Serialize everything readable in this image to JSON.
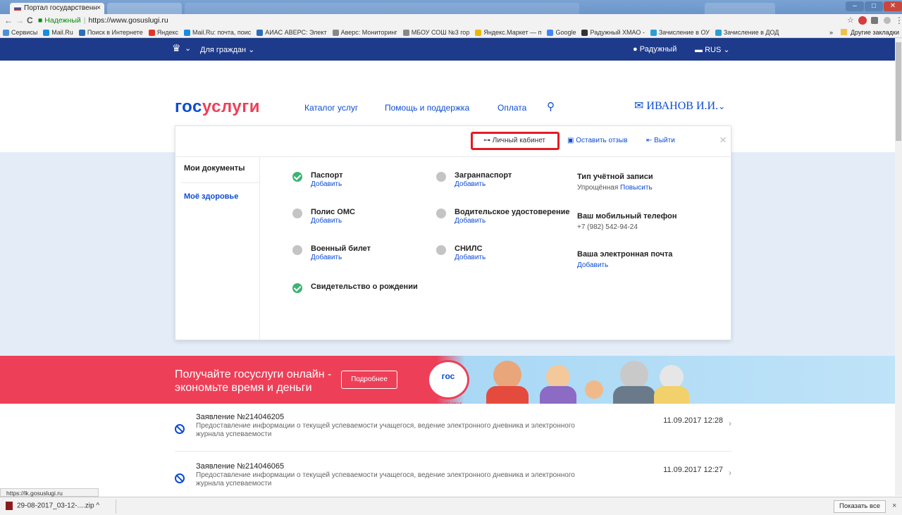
{
  "browser": {
    "tab_title": "Портал государственн",
    "tab_close": "×",
    "back": "←",
    "forward": "→",
    "reload": "C",
    "secure_label": "Надежный",
    "url": "https://www.gosuslugi.ru",
    "bookmarks": [
      {
        "label": "Сервисы",
        "color": "#4a90d9"
      },
      {
        "label": "Mail.Ru",
        "color": "#168de2"
      },
      {
        "label": "Поиск в Интернете",
        "color": "#2a6ebb"
      },
      {
        "label": "Яндекс",
        "color": "#e6332a"
      },
      {
        "label": "Mail.Ru: почта, поис",
        "color": "#168de2"
      },
      {
        "label": "АИАС АВЕРС: Элект",
        "color": "#2a6ebb"
      },
      {
        "label": "Аверс: Мониторинг",
        "color": "#888888"
      },
      {
        "label": "МБОУ СОШ №3 гор",
        "color": "#888888"
      },
      {
        "label": "Яндекс.Маркет — п",
        "color": "#f0b400"
      },
      {
        "label": "Google",
        "color": "#4285f4"
      },
      {
        "label": "Радужный ХМАО -",
        "color": "#333333"
      },
      {
        "label": "Зачисление в ОУ",
        "color": "#2a9fd6"
      },
      {
        "label": "Зачисление в ДОД",
        "color": "#2a9fd6"
      }
    ],
    "bookmarks_more": "»",
    "other_bookmarks": "Другие закладки",
    "status_url": "https://lk.gosuslugi.ru"
  },
  "site_nav": {
    "emblem_label": "⌄",
    "for_citizens": "Для граждан",
    "location": "Радужный",
    "language": "RUS"
  },
  "header": {
    "logo_part1": "гос",
    "logo_part2": "услуги",
    "nav": [
      "Каталог услуг",
      "Помощь и поддержка",
      "Оплата"
    ],
    "user_name": "ИВАНОВ И.И."
  },
  "panel": {
    "personal_cabinet": "Личный кабинет",
    "leave_feedback": "Оставить отзыв",
    "logout": "Выйти",
    "close": "×",
    "sidebar": [
      "Мои документы",
      "Моё здоровье"
    ],
    "documents_col1": [
      {
        "name": "Паспорт",
        "link": "Добавить",
        "done": true
      },
      {
        "name": "Полис ОМС",
        "link": "Добавить",
        "done": false
      },
      {
        "name": "Военный билет",
        "link": "Добавить",
        "done": false
      },
      {
        "name": "Свидетельство о рождении",
        "link": "",
        "done": true
      }
    ],
    "documents_col2": [
      {
        "name": "Загранпаспорт",
        "link": "Добавить",
        "done": false
      },
      {
        "name": "Водительское удостоверение",
        "link": "Добавить",
        "done": false
      },
      {
        "name": "СНИЛС",
        "link": "Добавить",
        "done": false
      }
    ],
    "account": {
      "type_label": "Тип учётной записи",
      "type_value": "Упрощённая",
      "type_upgrade": "Повысить",
      "phone_label": "Ваш мобильный телефон",
      "phone_value": "+7 (982) 542-94-24",
      "email_label": "Ваша электронная почта",
      "email_link": "Добавить"
    }
  },
  "banner": {
    "text": "Получайте госуслуги онлайн - экономьте время и деньги",
    "button": "Подробнее",
    "logo_line1": "гос",
    "logo_line2": "услуги"
  },
  "applications": [
    {
      "title": "Заявление №214046205",
      "desc": "Предоставление информации о текущей успеваемости учащегося, ведение электронного дневника и электронного журнала успеваемости",
      "date": "11.09.2017 12:28"
    },
    {
      "title": "Заявление №214046065",
      "desc": "Предоставление информации о текущей успеваемости учащегося, ведение электронного дневника и электронного журнала успеваемости",
      "date": "11.09.2017 12:27"
    }
  ],
  "downloads": {
    "file": "29-08-2017_03-12-....zip",
    "show_all": "Показать все",
    "close": "×"
  }
}
